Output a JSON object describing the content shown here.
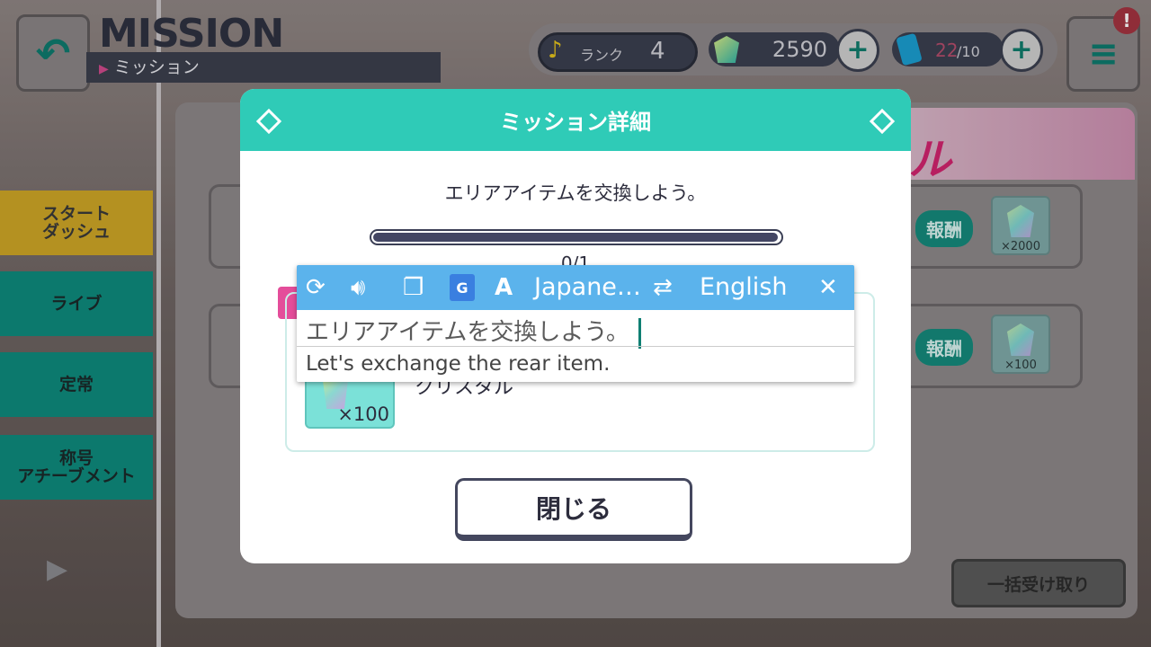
{
  "header": {
    "title": "MISSION",
    "subtitle": "ミッション"
  },
  "status_bar": {
    "rank_label": "ランク",
    "rank_value": "4",
    "crystals": "2590",
    "stamina_current": "22",
    "stamina_max": "/10",
    "alert": "!"
  },
  "sidebar": {
    "items": [
      {
        "label": "スタート\nダッシュ"
      },
      {
        "label": "ライブ"
      },
      {
        "label": "定常"
      },
      {
        "label": "称号\nアチーブメント"
      }
    ]
  },
  "background": {
    "banner_text": "ルGET！",
    "missions": [
      {
        "reward_label": "報酬",
        "reward_count": "×2000"
      },
      {
        "reward_label": "報酬",
        "reward_count": "×100"
      }
    ],
    "bulk_button": "一括受け取り"
  },
  "modal": {
    "title": "ミッション詳細",
    "description": "エリアアイテムを交換しよう。",
    "progress": {
      "current": 0,
      "max": 1,
      "text": "0/1"
    },
    "reward_count": "×100",
    "reward_name": "クリスタル",
    "close_button": "閉じる"
  },
  "translate_popup": {
    "source_lang": "Japane…",
    "target_lang": "English",
    "source_text": "エリアアイテムを交換しよう。",
    "result_text": "Let's exchange the rear item.",
    "icons": [
      "refresh-icon",
      "speaker-icon",
      "copy-icon",
      "google-translate-icon",
      "font-icon",
      "swap-icon",
      "close-icon"
    ]
  },
  "colors": {
    "modal_header": "#2fcbb7",
    "translate_toolbar": "#5bb3ec",
    "progress_fill": "#434663",
    "accent_teal": "#0e8a7d"
  }
}
